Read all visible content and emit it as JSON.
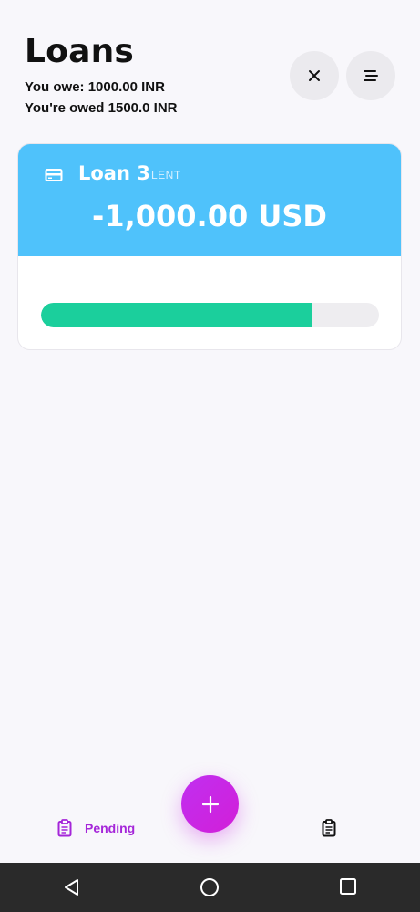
{
  "header": {
    "title": "Loans",
    "you_owe": "You owe: 1000.00 INR",
    "you_are_owed": "You're owed 1500.0 INR"
  },
  "toolbar": {
    "close_icon": "close-icon",
    "filter_icon": "sort-lines-icon"
  },
  "loans": [
    {
      "name": "Loan 3",
      "type": "LENT",
      "amount": "-1,000.00 USD",
      "progress_fraction": 0.8,
      "header_color": "#4fc2fb",
      "progress_color": "#1bcf9c"
    }
  ],
  "bottom_nav": {
    "pending_label": "Pending",
    "accent_color": "#a526d9",
    "fab_icon": "plus-icon",
    "second_tab_icon": "clipboard-icon"
  },
  "system_nav": {
    "back": "back-triangle-icon",
    "home": "home-circle-icon",
    "recents": "recents-square-icon"
  }
}
